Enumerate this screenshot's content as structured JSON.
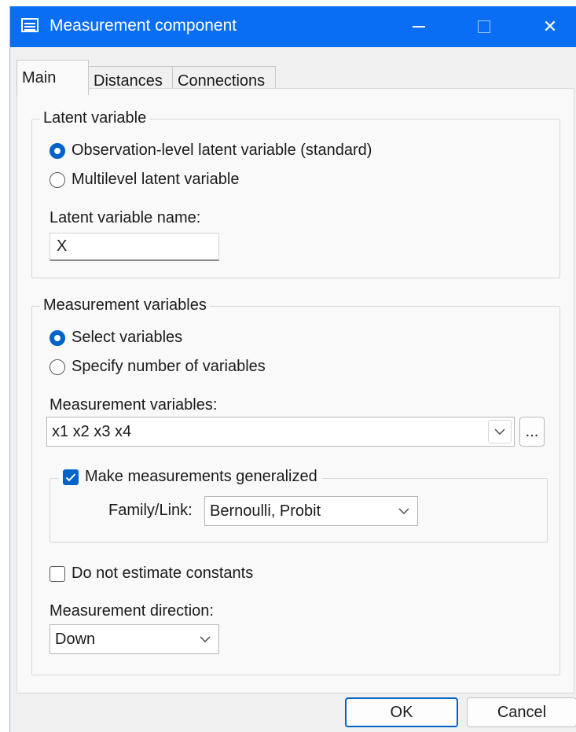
{
  "window": {
    "title": "Measurement component",
    "controls": {
      "minimize_icon": "minimize-icon",
      "maximize_icon": "maximize-icon",
      "close_icon": "close-icon",
      "close_glyph": "✕"
    }
  },
  "tabs": [
    {
      "label": "Main",
      "active": true
    },
    {
      "label": "Distances",
      "active": false
    },
    {
      "label": "Connections",
      "active": false
    }
  ],
  "latent_group": {
    "legend": "Latent variable",
    "options": [
      {
        "label": "Observation-level latent variable (standard)",
        "selected": true
      },
      {
        "label": "Multilevel latent variable",
        "selected": false
      }
    ],
    "name_label": "Latent variable name:",
    "name_value": "X"
  },
  "measurement_group": {
    "legend": "Measurement variables",
    "options": [
      {
        "label": "Select variables",
        "selected": true
      },
      {
        "label": "Specify number of variables",
        "selected": false
      }
    ],
    "variables_label": "Measurement variables:",
    "variables_value": "x1 x2 x3 x4",
    "browse_label": "...",
    "generalized": {
      "label": "Make measurements generalized",
      "checked": true,
      "family_label": "Family/Link:",
      "family_value": "Bernoulli, Probit"
    },
    "no_constants": {
      "label": "Do not estimate constants",
      "checked": false
    },
    "direction_label": "Measurement direction:",
    "direction_value": "Down"
  },
  "footer": {
    "ok_label": "OK",
    "cancel_label": "Cancel"
  },
  "colors": {
    "titlebar": "#0a6ef5",
    "accent": "#0063c9",
    "dialog_bg": "#f0f0f0",
    "panel_bg": "#f9f9f9"
  }
}
